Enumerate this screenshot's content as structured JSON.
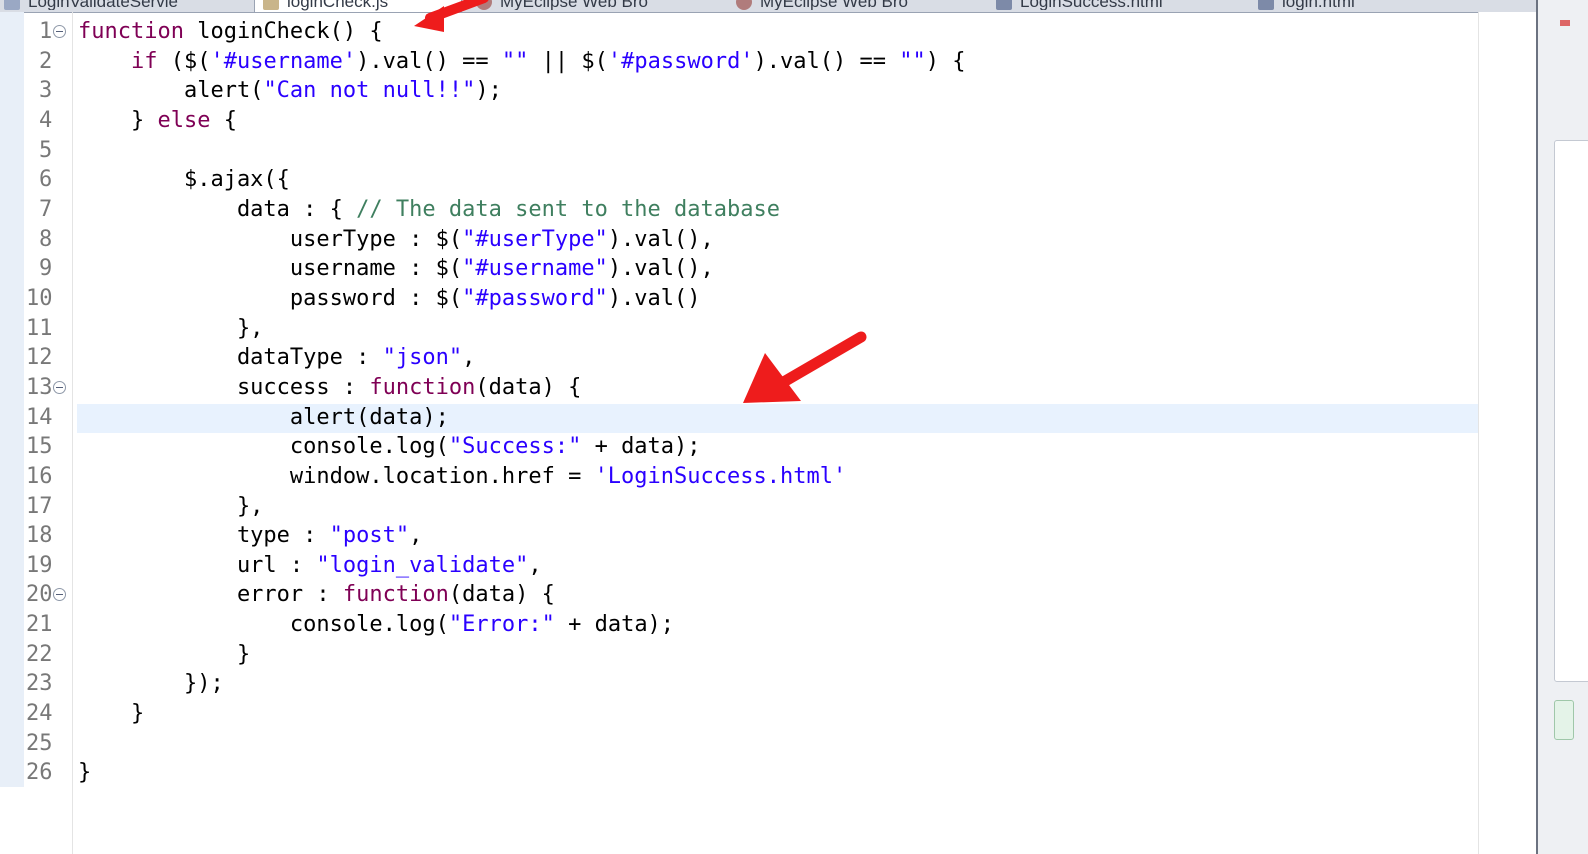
{
  "tabs": [
    {
      "label": "LoginValidateServle",
      "icon": "java-file-icon"
    },
    {
      "label": "loginCheck.js",
      "icon": "js-file-icon"
    },
    {
      "label": "MyEclipse Web Bro",
      "icon": "browser-icon"
    },
    {
      "label": "MyEclipse Web Bro",
      "icon": "browser-icon"
    },
    {
      "label": "LoginSuccess.html",
      "icon": "html-file-icon"
    },
    {
      "label": "login.html",
      "icon": "html-file-icon"
    }
  ],
  "editor": {
    "line_numbers": [
      "1",
      "2",
      "3",
      "4",
      "5",
      "6",
      "7",
      "8",
      "9",
      "10",
      "11",
      "12",
      "13",
      "14",
      "15",
      "16",
      "17",
      "18",
      "19",
      "20",
      "21",
      "22",
      "23",
      "24",
      "25",
      "26"
    ],
    "folded_lines": [
      "1",
      "13",
      "20"
    ],
    "current_line": "14",
    "code_lines": [
      "function loginCheck() {",
      "    if ($('#username').val() == \"\" || $('#password').val() == \"\") {",
      "        alert(\"Can not null!!\");",
      "    } else {",
      "",
      "        $.ajax({",
      "            data : { // The data sent to the database",
      "                userType : $(\"#userType\").val(),",
      "                username : $(\"#username\").val(),",
      "                password : $(\"#password\").val()",
      "            },",
      "            dataType : \"json\",",
      "            success : function(data) {",
      "                alert(data);",
      "                console.log(\"Success:\" + data);",
      "                window.location.href = 'LoginSuccess.html'",
      "            },",
      "            type : \"post\",",
      "            url : \"login_validate\",",
      "            error : function(data) {",
      "                console.log(\"Error:\" + data);",
      "            }",
      "        });",
      "    }",
      "",
      "}"
    ]
  },
  "annotations": {
    "arrow_color": "#ee1c1c"
  },
  "colors": {
    "keyword": "#7f0055",
    "string": "#2a00ff",
    "comment": "#3f7f5f",
    "current_line_bg": "#e8f2fe"
  }
}
